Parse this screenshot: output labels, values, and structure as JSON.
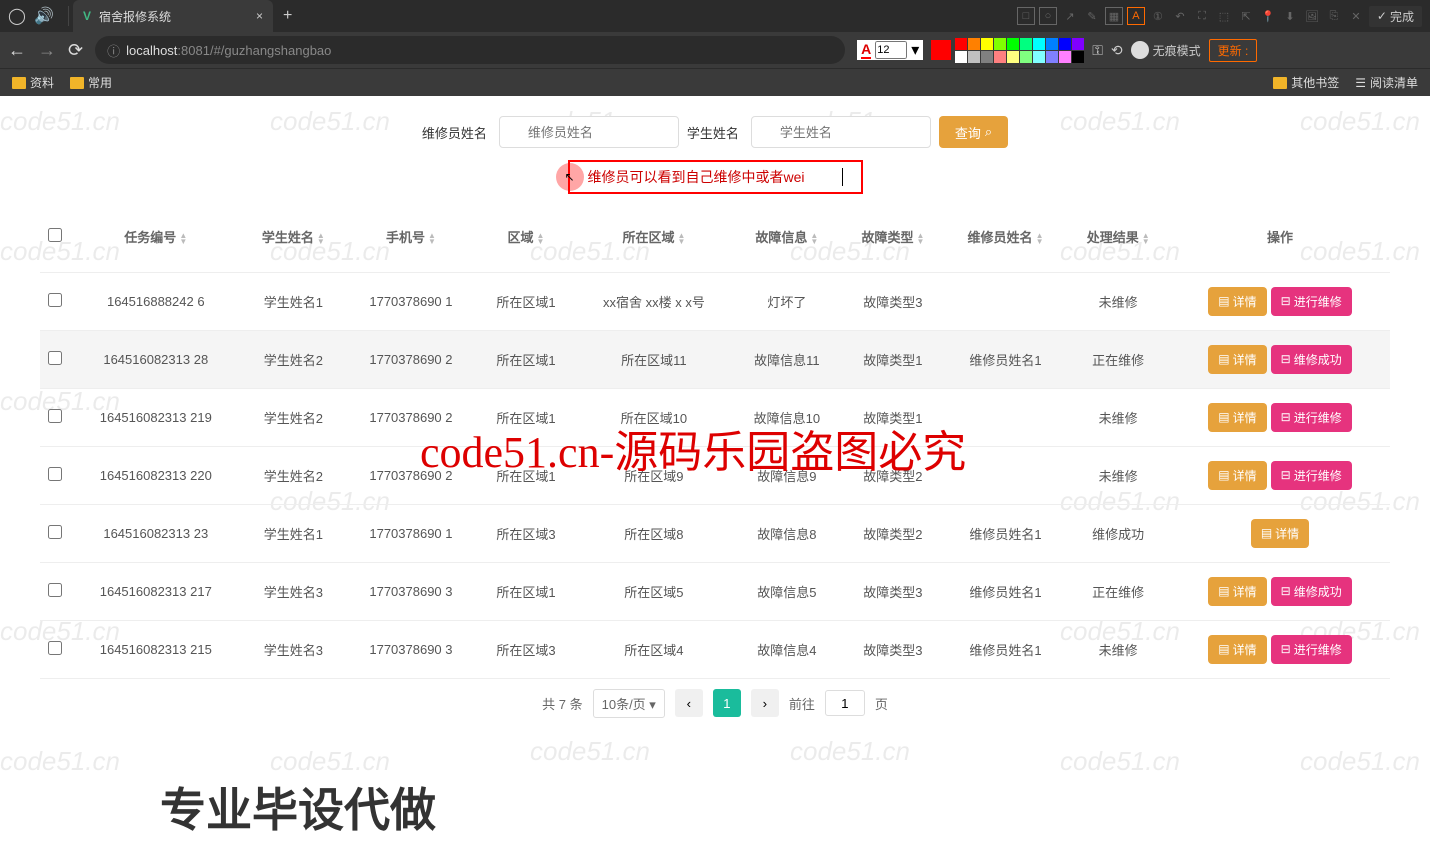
{
  "browser": {
    "tab_title": "宿舍报修系统",
    "url_host": "localhost",
    "url_port_path": ":8081/#/guzhangshangbao",
    "bookmarks_left": [
      "资料",
      "常用"
    ],
    "bookmarks_right": [
      "其他书签",
      "阅读清单"
    ],
    "incognito": "无痕模式",
    "update": "更新",
    "done": "完成",
    "font_size": "12"
  },
  "search": {
    "label1": "维修员姓名",
    "placeholder1": "维修员姓名",
    "label2": "学生姓名",
    "placeholder2": "学生姓名",
    "query_btn": "查询"
  },
  "annotation": "维修员可以看到自己维修中或者wei",
  "table": {
    "headers": [
      "任务编号",
      "学生姓名",
      "手机号",
      "区域",
      "所在区域",
      "故障信息",
      "故障类型",
      "维修员姓名",
      "处理结果",
      "操作"
    ],
    "rows": [
      {
        "id": "164516888242 6",
        "stu": "学生姓名1",
        "phone": "1770378690 1",
        "area": "所在区域1",
        "loc": "xx宿舍 xx楼 x x号",
        "fault": "灯坏了",
        "type": "故障类型3",
        "worker": "",
        "result": "未维修",
        "actions": [
          "详情",
          "进行维修"
        ]
      },
      {
        "id": "164516082313 28",
        "stu": "学生姓名2",
        "phone": "1770378690 2",
        "area": "所在区域1",
        "loc": "所在区域11",
        "fault": "故障信息11",
        "type": "故障类型1",
        "worker": "维修员姓名1",
        "result": "正在维修",
        "actions": [
          "详情",
          "维修成功"
        ]
      },
      {
        "id": "164516082313 219",
        "stu": "学生姓名2",
        "phone": "1770378690 2",
        "area": "所在区域1",
        "loc": "所在区域10",
        "fault": "故障信息10",
        "type": "故障类型1",
        "worker": "",
        "result": "未维修",
        "actions": [
          "详情",
          "进行维修"
        ]
      },
      {
        "id": "164516082313 220",
        "stu": "学生姓名2",
        "phone": "1770378690 2",
        "area": "所在区域1",
        "loc": "所在区域9",
        "fault": "故障信息9",
        "type": "故障类型2",
        "worker": "",
        "result": "未维修",
        "actions": [
          "详情",
          "进行维修"
        ]
      },
      {
        "id": "164516082313 23",
        "stu": "学生姓名1",
        "phone": "1770378690 1",
        "area": "所在区域3",
        "loc": "所在区域8",
        "fault": "故障信息8",
        "type": "故障类型2",
        "worker": "维修员姓名1",
        "result": "维修成功",
        "actions": [
          "详情"
        ]
      },
      {
        "id": "164516082313 217",
        "stu": "学生姓名3",
        "phone": "1770378690 3",
        "area": "所在区域1",
        "loc": "所在区域5",
        "fault": "故障信息5",
        "type": "故障类型3",
        "worker": "维修员姓名1",
        "result": "正在维修",
        "actions": [
          "详情",
          "维修成功"
        ]
      },
      {
        "id": "164516082313 215",
        "stu": "学生姓名3",
        "phone": "1770378690 3",
        "area": "所在区域3",
        "loc": "所在区域4",
        "fault": "故障信息4",
        "type": "故障类型3",
        "worker": "维修员姓名1",
        "result": "未维修",
        "actions": [
          "详情",
          "进行维修"
        ]
      }
    ]
  },
  "pagination": {
    "total": "共 7 条",
    "per_page": "10条/页",
    "page": "1",
    "goto": "前往",
    "page_input": "1",
    "page_suffix": "页"
  },
  "watermarks": {
    "small": "code51.cn",
    "big": "code51.cn-源码乐园盗图必究",
    "bottom": "专业毕设代做"
  },
  "colors": [
    "#ff0000",
    "#ff8000",
    "#ffff00",
    "#80ff00",
    "#00ff00",
    "#00ff80",
    "#00ffff",
    "#0080ff",
    "#0000ff",
    "#8000ff",
    "#ffffff",
    "#c0c0c0",
    "#808080",
    "#ff8080",
    "#ffff80",
    "#80ff80",
    "#80ffff",
    "#8080ff",
    "#ff80ff",
    "#000000"
  ]
}
